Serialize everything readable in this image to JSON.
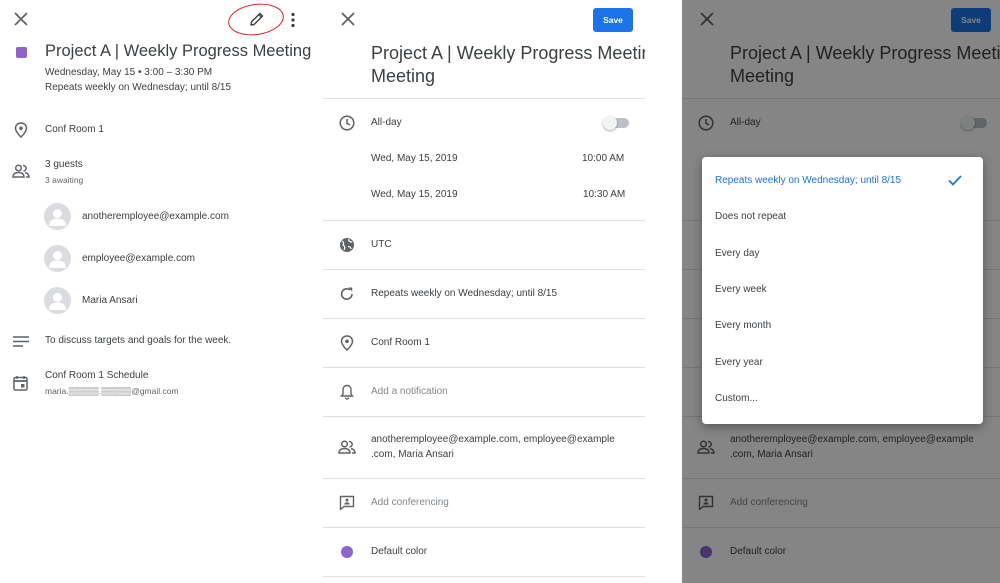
{
  "colors": {
    "accent": "#1a73e8",
    "event": "#8e63ce",
    "annotation": "#e02020"
  },
  "view": {
    "title": "Project A | Weekly Progress Meeting",
    "datetime": "Wednesday, May 15  •  3:00 – 3:30 PM",
    "recurrence": "Repeats weekly on Wednesday; until 8/15",
    "location": "Conf Room 1",
    "guests_title": "3 guests",
    "guests_sub": "3 awaiting",
    "guests": [
      "anotheremployee@example.com",
      "employee@example.com",
      "Maria Ansari"
    ],
    "description": "To discuss targets and goals for the week.",
    "calendar_name": "Conf Room 1 Schedule",
    "calendar_owner": "maria.▒▒▒▒▒.▒▒▒▒▒@gmail.com",
    "icons": [
      "close-icon",
      "edit-pencil-icon",
      "more-vert-icon",
      "location-pin-icon",
      "people-icon",
      "notes-icon",
      "calendar-icon"
    ]
  },
  "edit": {
    "save_label": "Save",
    "title": "Project A | Weekly Progress Meeting",
    "allday_label": "All-day",
    "allday_on": false,
    "start_date": "Wed, May 15, 2019",
    "start_time": "10:00 AM",
    "end_date": "Wed, May 15, 2019",
    "end_time": "10:30 AM",
    "timezone": "UTC",
    "recurrence": "Repeats weekly on Wednesday; until 8/15",
    "location": "Conf Room 1",
    "notification_placeholder": "Add a notification",
    "guests_line1": "anotheremployee@example.com, employee@example",
    "guests_line2": ".com, Maria Ansari",
    "conferencing_placeholder": "Add conferencing",
    "color_label": "Default color"
  },
  "repeat_menu": {
    "items": [
      "Repeats weekly on Wednesday; until 8/15",
      "Does not repeat",
      "Every day",
      "Every week",
      "Every month",
      "Every year",
      "Custom..."
    ],
    "selected_index": 0
  }
}
